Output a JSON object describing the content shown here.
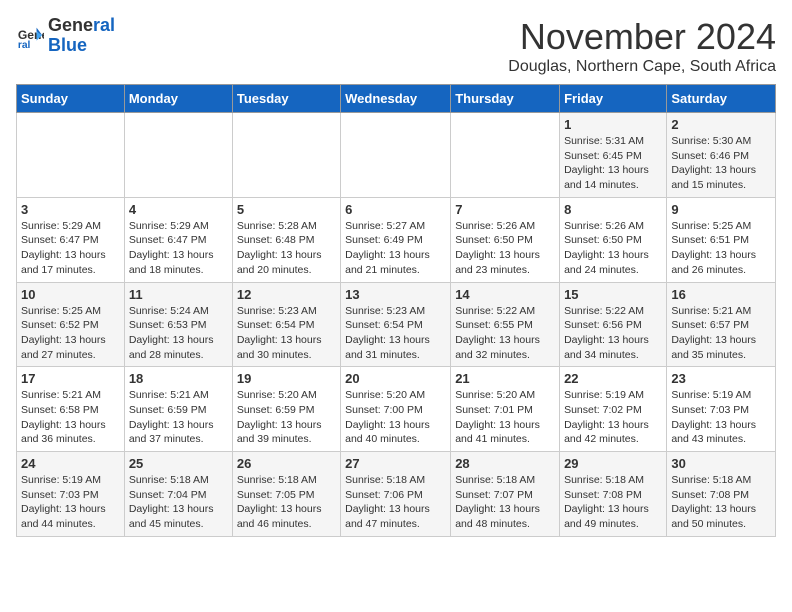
{
  "logo": {
    "line1": "General",
    "line2": "Blue"
  },
  "title": "November 2024",
  "location": "Douglas, Northern Cape, South Africa",
  "days_header": [
    "Sunday",
    "Monday",
    "Tuesday",
    "Wednesday",
    "Thursday",
    "Friday",
    "Saturday"
  ],
  "weeks": [
    [
      {
        "day": "",
        "info": ""
      },
      {
        "day": "",
        "info": ""
      },
      {
        "day": "",
        "info": ""
      },
      {
        "day": "",
        "info": ""
      },
      {
        "day": "",
        "info": ""
      },
      {
        "day": "1",
        "info": "Sunrise: 5:31 AM\nSunset: 6:45 PM\nDaylight: 13 hours and 14 minutes."
      },
      {
        "day": "2",
        "info": "Sunrise: 5:30 AM\nSunset: 6:46 PM\nDaylight: 13 hours and 15 minutes."
      }
    ],
    [
      {
        "day": "3",
        "info": "Sunrise: 5:29 AM\nSunset: 6:47 PM\nDaylight: 13 hours and 17 minutes."
      },
      {
        "day": "4",
        "info": "Sunrise: 5:29 AM\nSunset: 6:47 PM\nDaylight: 13 hours and 18 minutes."
      },
      {
        "day": "5",
        "info": "Sunrise: 5:28 AM\nSunset: 6:48 PM\nDaylight: 13 hours and 20 minutes."
      },
      {
        "day": "6",
        "info": "Sunrise: 5:27 AM\nSunset: 6:49 PM\nDaylight: 13 hours and 21 minutes."
      },
      {
        "day": "7",
        "info": "Sunrise: 5:26 AM\nSunset: 6:50 PM\nDaylight: 13 hours and 23 minutes."
      },
      {
        "day": "8",
        "info": "Sunrise: 5:26 AM\nSunset: 6:50 PM\nDaylight: 13 hours and 24 minutes."
      },
      {
        "day": "9",
        "info": "Sunrise: 5:25 AM\nSunset: 6:51 PM\nDaylight: 13 hours and 26 minutes."
      }
    ],
    [
      {
        "day": "10",
        "info": "Sunrise: 5:25 AM\nSunset: 6:52 PM\nDaylight: 13 hours and 27 minutes."
      },
      {
        "day": "11",
        "info": "Sunrise: 5:24 AM\nSunset: 6:53 PM\nDaylight: 13 hours and 28 minutes."
      },
      {
        "day": "12",
        "info": "Sunrise: 5:23 AM\nSunset: 6:54 PM\nDaylight: 13 hours and 30 minutes."
      },
      {
        "day": "13",
        "info": "Sunrise: 5:23 AM\nSunset: 6:54 PM\nDaylight: 13 hours and 31 minutes."
      },
      {
        "day": "14",
        "info": "Sunrise: 5:22 AM\nSunset: 6:55 PM\nDaylight: 13 hours and 32 minutes."
      },
      {
        "day": "15",
        "info": "Sunrise: 5:22 AM\nSunset: 6:56 PM\nDaylight: 13 hours and 34 minutes."
      },
      {
        "day": "16",
        "info": "Sunrise: 5:21 AM\nSunset: 6:57 PM\nDaylight: 13 hours and 35 minutes."
      }
    ],
    [
      {
        "day": "17",
        "info": "Sunrise: 5:21 AM\nSunset: 6:58 PM\nDaylight: 13 hours and 36 minutes."
      },
      {
        "day": "18",
        "info": "Sunrise: 5:21 AM\nSunset: 6:59 PM\nDaylight: 13 hours and 37 minutes."
      },
      {
        "day": "19",
        "info": "Sunrise: 5:20 AM\nSunset: 6:59 PM\nDaylight: 13 hours and 39 minutes."
      },
      {
        "day": "20",
        "info": "Sunrise: 5:20 AM\nSunset: 7:00 PM\nDaylight: 13 hours and 40 minutes."
      },
      {
        "day": "21",
        "info": "Sunrise: 5:20 AM\nSunset: 7:01 PM\nDaylight: 13 hours and 41 minutes."
      },
      {
        "day": "22",
        "info": "Sunrise: 5:19 AM\nSunset: 7:02 PM\nDaylight: 13 hours and 42 minutes."
      },
      {
        "day": "23",
        "info": "Sunrise: 5:19 AM\nSunset: 7:03 PM\nDaylight: 13 hours and 43 minutes."
      }
    ],
    [
      {
        "day": "24",
        "info": "Sunrise: 5:19 AM\nSunset: 7:03 PM\nDaylight: 13 hours and 44 minutes."
      },
      {
        "day": "25",
        "info": "Sunrise: 5:18 AM\nSunset: 7:04 PM\nDaylight: 13 hours and 45 minutes."
      },
      {
        "day": "26",
        "info": "Sunrise: 5:18 AM\nSunset: 7:05 PM\nDaylight: 13 hours and 46 minutes."
      },
      {
        "day": "27",
        "info": "Sunrise: 5:18 AM\nSunset: 7:06 PM\nDaylight: 13 hours and 47 minutes."
      },
      {
        "day": "28",
        "info": "Sunrise: 5:18 AM\nSunset: 7:07 PM\nDaylight: 13 hours and 48 minutes."
      },
      {
        "day": "29",
        "info": "Sunrise: 5:18 AM\nSunset: 7:08 PM\nDaylight: 13 hours and 49 minutes."
      },
      {
        "day": "30",
        "info": "Sunrise: 5:18 AM\nSunset: 7:08 PM\nDaylight: 13 hours and 50 minutes."
      }
    ]
  ]
}
